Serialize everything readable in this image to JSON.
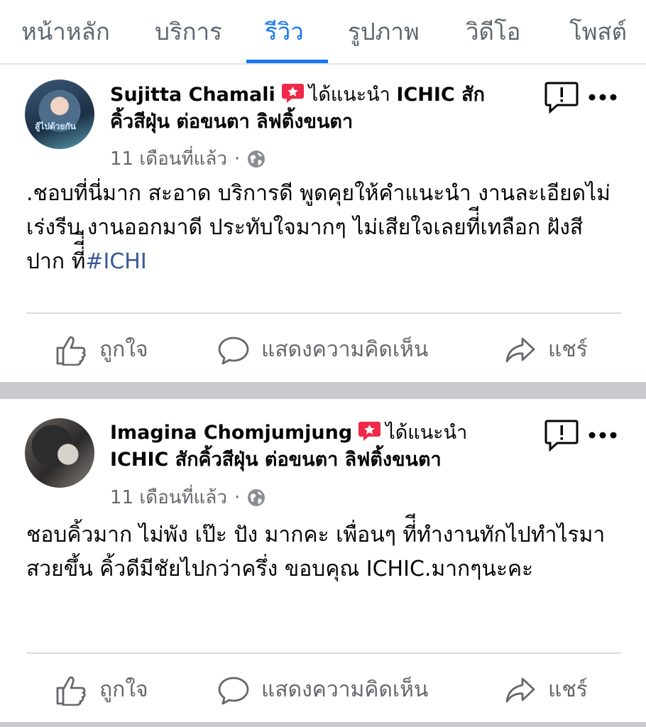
{
  "tabs": [
    {
      "label": "หน้าหลัก",
      "active": false
    },
    {
      "label": "บริการ",
      "active": false
    },
    {
      "label": "รีวิว",
      "active": true
    },
    {
      "label": "รูปภาพ",
      "active": false
    },
    {
      "label": "วิดีโอ",
      "active": false
    },
    {
      "label": "โพสต์",
      "active": false
    }
  ],
  "accent_color": "#1877f2",
  "recommend_color": "#f02849",
  "reviews": [
    {
      "reviewer": "Sujitta Chamali",
      "recommend_text": "ได้แนะนำ",
      "page_line1": "ICHIC สัก",
      "page_line2": "คิ้วสีฝุ่น ต่อขนตา ลิฟติ้งขนตา",
      "time": "11 เดือนที่แล้ว",
      "dot": "·",
      "avatar_text": "สู้ไปด้วยกัน",
      "text_main": ".ชอบที่นี่มาก สะอาด บริการดี  พูดคุยให้คำแนะนำ งานละเอียดไม่เร่งรีบ งานออกมาดี  ประทับใจมากๆ ไม่เสียใจเลยที่ีเทลือก ฝังสีปาก ที่ี่ี",
      "hashtag": "#ICHI"
    },
    {
      "reviewer": "Imagina Chomjumjung",
      "recommend_text": "ได้แนะนำ",
      "page_line1": "ICHIC สักคิ้วสีฝุ่น ต่อขนตา ลิฟติ้งขนตา",
      "page_line2": "",
      "time": "11 เดือนที่แล้ว",
      "dot": "·",
      "text_main": "ชอบคิ้วมาก ไม่พัง เป๊ะ ปัง มากคะ เพื่อนๆ ที่ีทำงานทักไปทำไรมาสวยขึ้น คิ้วดีมีชัยไปกว่าครึ่ง ขอบคุณ ICHIC.มากๆนะคะ",
      "hashtag": ""
    }
  ],
  "actions": {
    "like": "ถูกใจ",
    "comment": "แสดงความคิดเห็น",
    "share": "แชร์"
  }
}
